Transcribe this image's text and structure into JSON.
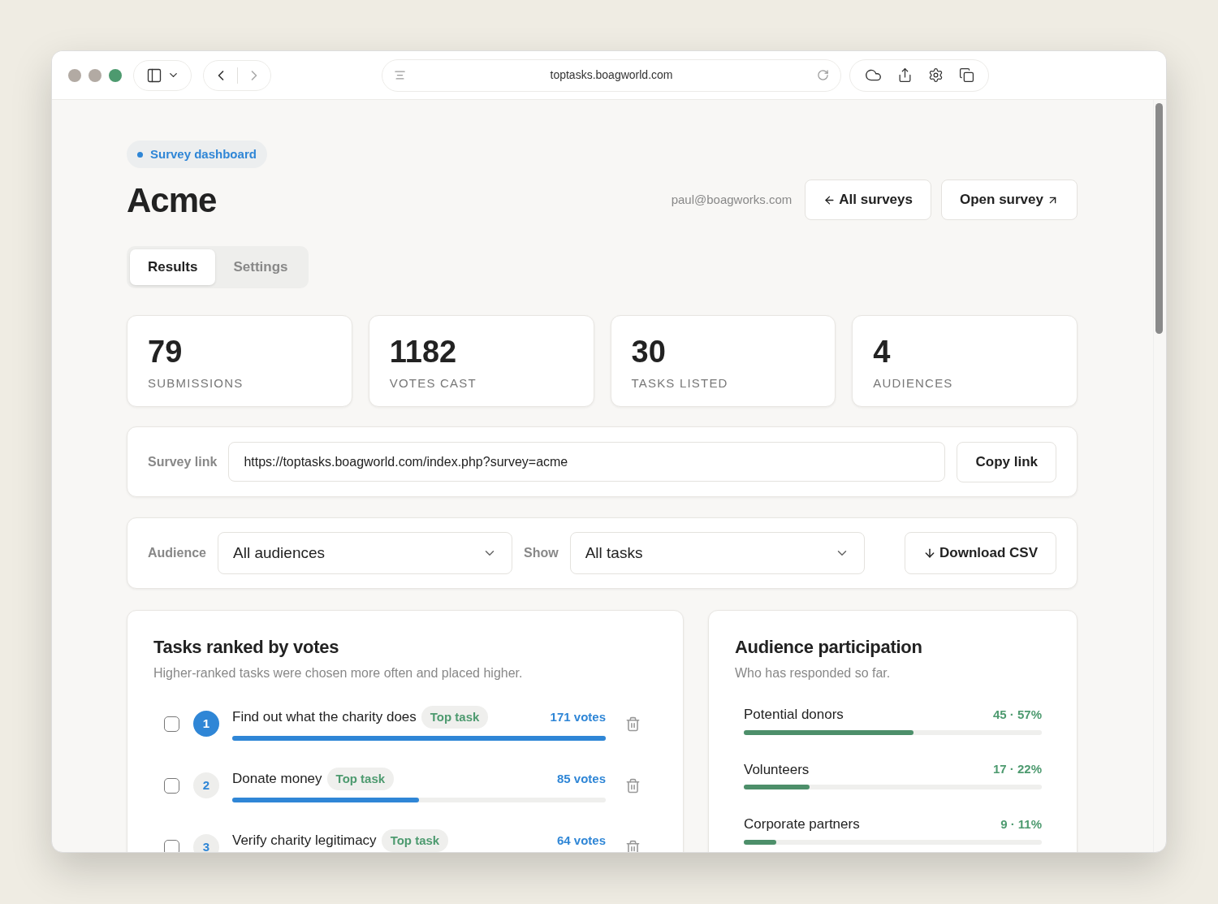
{
  "browser": {
    "url": "toptasks.boagworld.com"
  },
  "badge": "Survey dashboard",
  "title": "Acme",
  "user_email": "paul@boagworks.com",
  "header_buttons": [
    {
      "label": "All surveys",
      "kind": "back"
    },
    {
      "label": "Open survey",
      "kind": "external"
    }
  ],
  "tabs": [
    {
      "label": "Results",
      "selected": true
    },
    {
      "label": "Settings",
      "selected": false
    }
  ],
  "stats": [
    {
      "value": "79",
      "label": "SUBMISSIONS"
    },
    {
      "value": "1182",
      "label": "VOTES CAST"
    },
    {
      "value": "30",
      "label": "TASKS LISTED"
    },
    {
      "value": "4",
      "label": "AUDIENCES"
    }
  ],
  "survey_link": {
    "label": "Survey link",
    "value": "https://toptasks.boagworld.com/index.php?survey=acme",
    "button": "Copy link"
  },
  "filters": [
    {
      "label": "Audience",
      "value": "All audiences"
    },
    {
      "label": "Show",
      "value": "All tasks"
    }
  ],
  "download_button": "Download CSV",
  "tasks_panel": {
    "title": "Tasks ranked by votes",
    "subtitle": "Higher-ranked tasks were chosen more often and placed higher.",
    "rows": [
      {
        "rank": "1",
        "name": "Find out what the charity does",
        "tag": "Top task",
        "votes": "171 votes",
        "checked": false,
        "highlight": true,
        "level": 1
      },
      {
        "rank": "2",
        "name": "Donate money",
        "tag": "Top task",
        "votes": "85 votes",
        "checked": false,
        "highlight": false,
        "level": 0.5
      },
      {
        "rank": "3",
        "name": "Verify charity legitimacy",
        "tag": "Top task",
        "votes": "64 votes",
        "checked": false,
        "highlight": false
      }
    ]
  },
  "audience_panel": {
    "title": "Audience participation",
    "subtitle": "Who has responded so far.",
    "rows": [
      {
        "name": "Potential donors",
        "reading": "45 · 57%",
        "level": 0.57
      },
      {
        "name": "Volunteers",
        "reading": "17 · 22%",
        "level": 0.22
      },
      {
        "name": "Corporate partners",
        "reading": "9 · 11%",
        "level": 0.11
      }
    ]
  }
}
